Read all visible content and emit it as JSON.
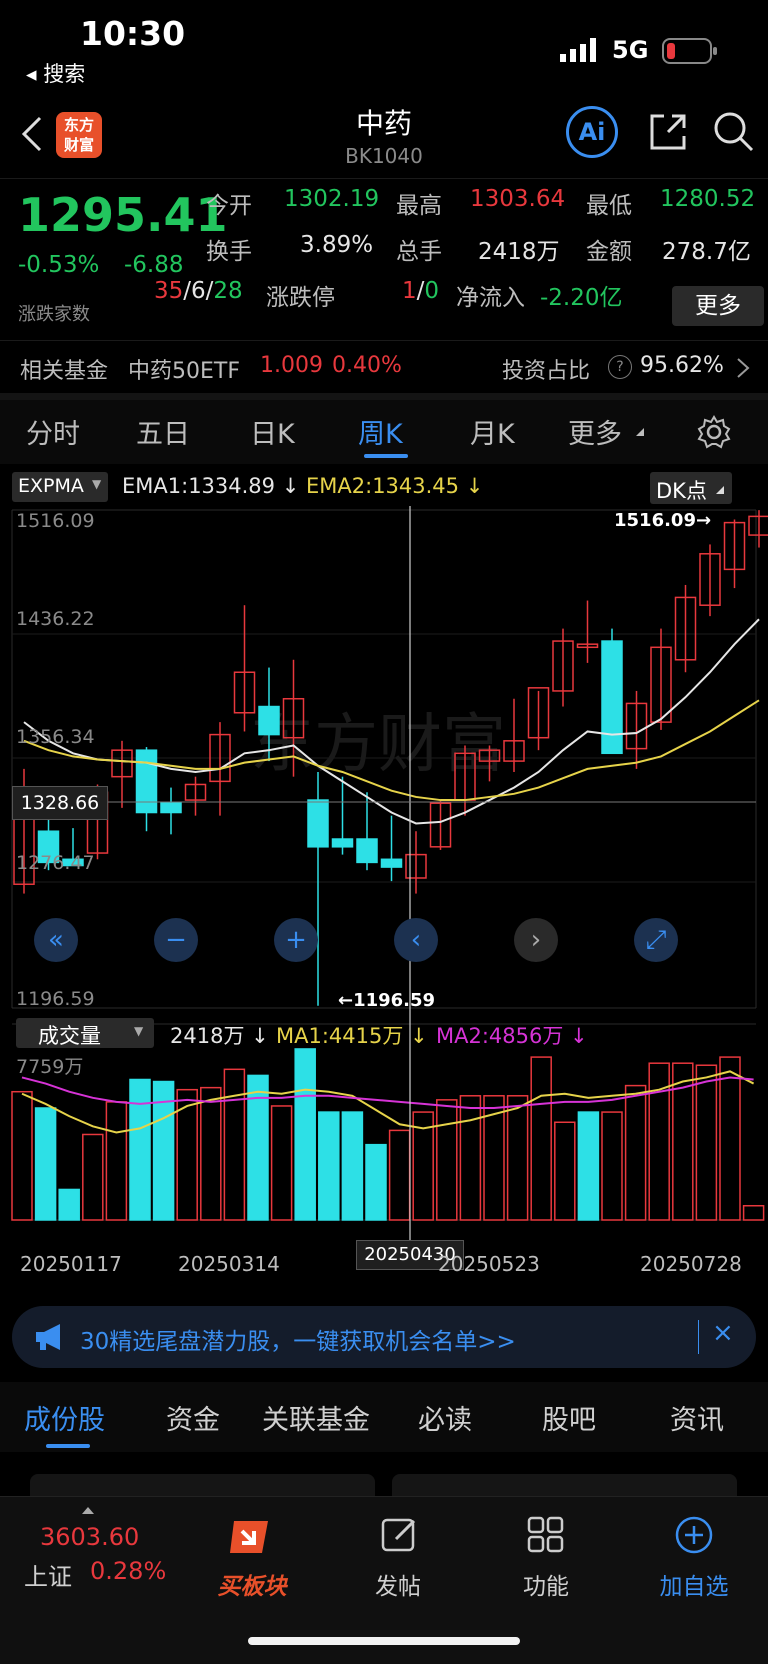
{
  "status_bar": {
    "time": "10:30",
    "back_label": "◂ 搜索",
    "network": "5G"
  },
  "header": {
    "title": "中药",
    "code": "BK1040",
    "logo_line1": "东方",
    "logo_line2": "财富",
    "ai_label": "Ai"
  },
  "quote": {
    "price": "1295.41",
    "change_pct": "-0.53%",
    "change": "-6.88",
    "open_label": "今开",
    "open": "1302.19",
    "high_label": "最高",
    "high": "1303.64",
    "low_label": "最低",
    "low": "1280.52",
    "turnover_label": "换手",
    "turnover": "3.89%",
    "volume_label": "总手",
    "volume": "2418万",
    "amount_label": "金额",
    "amount": "278.7亿",
    "updown_label": "涨跌家数",
    "up": "35",
    "flat": "6",
    "down": "28",
    "limit_label": "涨跌停",
    "limit_up": "1",
    "limit_down": "0",
    "netflow_label": "净流入",
    "netflow": "-2.20亿",
    "more": "更多"
  },
  "fund": {
    "label": "相关基金",
    "name": "中药50ETF",
    "price": "1.009",
    "pct": "0.40%",
    "ratio_label": "投资占比",
    "ratio": "95.62%"
  },
  "tabs": [
    "分时",
    "五日",
    "日K",
    "周K",
    "月K",
    "更多"
  ],
  "active_tab": "周K",
  "indicator": {
    "name": "EXPMA",
    "ema1": "EMA1:1334.89 ↓",
    "ema2": "EMA2:1343.45 ↓",
    "dk": "DK点"
  },
  "axis": {
    "y1": "1516.09",
    "y2": "1436.22",
    "y3": "1356.34",
    "y4": "1276.47",
    "y5": "1196.59",
    "crosshair_price": "1328.66",
    "max_mark": "1516.09→",
    "min_mark": "←1196.59"
  },
  "volume": {
    "name": "成交量",
    "value": "2418万 ↓",
    "ma1": "MA1:4415万 ↓",
    "ma2": "MA2:4856万 ↓",
    "max": "7759万"
  },
  "dates": {
    "d1": "20250117",
    "d2": "20250314",
    "d3": "20250430",
    "d4": "20250523",
    "d5": "20250728"
  },
  "colors": {
    "up": "#e8383d",
    "down": "#2de0e6",
    "ema1": "#e6e6e6",
    "ema2": "#e6d34a",
    "ma2": "#d633d6",
    "accent": "#3a8ef0"
  },
  "chart_data": {
    "type": "candlestick",
    "ylim": [
      1196.59,
      1516.09
    ],
    "candles": [
      {
        "o": 1276,
        "h": 1350,
        "l": 1270,
        "c": 1330
      },
      {
        "o": 1310,
        "h": 1330,
        "l": 1285,
        "c": 1290
      },
      {
        "o": 1292,
        "h": 1312,
        "l": 1288,
        "c": 1288
      },
      {
        "o": 1296,
        "h": 1340,
        "l": 1292,
        "c": 1335
      },
      {
        "o": 1345,
        "h": 1368,
        "l": 1325,
        "c": 1362
      },
      {
        "o": 1362,
        "h": 1364,
        "l": 1310,
        "c": 1322
      },
      {
        "o": 1328,
        "h": 1338,
        "l": 1308,
        "c": 1322
      },
      {
        "o": 1330,
        "h": 1345,
        "l": 1320,
        "c": 1340
      },
      {
        "o": 1342,
        "h": 1380,
        "l": 1320,
        "c": 1372
      },
      {
        "o": 1386,
        "h": 1455,
        "l": 1374,
        "c": 1412
      },
      {
        "o": 1390,
        "h": 1415,
        "l": 1355,
        "c": 1372
      },
      {
        "o": 1370,
        "h": 1420,
        "l": 1345,
        "c": 1395
      },
      {
        "o": 1330,
        "h": 1348,
        "l": 1198,
        "c": 1300
      },
      {
        "o": 1305,
        "h": 1345,
        "l": 1295,
        "c": 1300
      },
      {
        "o": 1305,
        "h": 1335,
        "l": 1285,
        "c": 1290
      },
      {
        "o": 1292,
        "h": 1320,
        "l": 1278,
        "c": 1287
      },
      {
        "o": 1280,
        "h": 1310,
        "l": 1270,
        "c": 1295
      },
      {
        "o": 1300,
        "h": 1330,
        "l": 1298,
        "c": 1328
      },
      {
        "o": 1330,
        "h": 1365,
        "l": 1320,
        "c": 1360
      },
      {
        "o": 1355,
        "h": 1365,
        "l": 1342,
        "c": 1362
      },
      {
        "o": 1355,
        "h": 1395,
        "l": 1348,
        "c": 1368
      },
      {
        "o": 1370,
        "h": 1400,
        "l": 1362,
        "c": 1402
      },
      {
        "o": 1400,
        "h": 1440,
        "l": 1390,
        "c": 1432
      },
      {
        "o": 1428,
        "h": 1458,
        "l": 1418,
        "c": 1430
      },
      {
        "o": 1432,
        "h": 1440,
        "l": 1360,
        "c": 1360
      },
      {
        "o": 1363,
        "h": 1400,
        "l": 1350,
        "c": 1392
      },
      {
        "o": 1380,
        "h": 1440,
        "l": 1375,
        "c": 1428
      },
      {
        "o": 1420,
        "h": 1468,
        "l": 1412,
        "c": 1460
      },
      {
        "o": 1455,
        "h": 1494,
        "l": 1448,
        "c": 1488
      },
      {
        "o": 1478,
        "h": 1510,
        "l": 1466,
        "c": 1508
      },
      {
        "o": 1500,
        "h": 1516,
        "l": 1492,
        "c": 1512
      }
    ],
    "ema1": [
      1380,
      1368,
      1360,
      1356,
      1355,
      1354,
      1350,
      1348,
      1350,
      1360,
      1362,
      1365,
      1352,
      1342,
      1332,
      1322,
      1315,
      1316,
      1322,
      1330,
      1338,
      1348,
      1362,
      1374,
      1372,
      1373,
      1382,
      1396,
      1412,
      1430,
      1446
    ],
    "ema2": [
      1368,
      1362,
      1358,
      1356,
      1355,
      1354,
      1352,
      1350,
      1350,
      1354,
      1356,
      1358,
      1352,
      1348,
      1342,
      1336,
      1332,
      1330,
      1330,
      1332,
      1334,
      1338,
      1344,
      1350,
      1352,
      1354,
      1358,
      1366,
      1374,
      1384,
      1394
    ],
    "volume": [
      6300,
      5500,
      1500,
      4200,
      5800,
      6900,
      6800,
      6400,
      6500,
      7400,
      7100,
      5600,
      8400,
      5300,
      5300,
      3700,
      4400,
      5300,
      5900,
      6100,
      6100,
      6100,
      8000,
      4800,
      5300,
      5300,
      6600,
      7700,
      7700,
      7600,
      8000,
      700
    ],
    "vol_ma1": [
      6200,
      5700,
      5100,
      4600,
      4300,
      4500,
      5000,
      5600,
      5900,
      6100,
      6300,
      6200,
      6400,
      6300,
      6100,
      5400,
      4700,
      4500,
      4700,
      4900,
      5200,
      5500,
      6100,
      6200,
      6000,
      6100,
      6200,
      6400,
      6800,
      7000,
      7300,
      6700
    ],
    "vol_ma2": [
      7000,
      6700,
      6300,
      6000,
      5800,
      5700,
      5800,
      5900,
      5800,
      5900,
      6000,
      6000,
      6100,
      6100,
      6000,
      5900,
      5800,
      5700,
      5600,
      5500,
      5500,
      5600,
      5700,
      5800,
      5800,
      5900,
      6100,
      6300,
      6500,
      6800,
      7000,
      6900
    ],
    "vol_ylim": [
      0,
      7759
    ]
  },
  "controls": [
    "«",
    "−",
    "+",
    "‹",
    "›",
    "⤢"
  ],
  "banner": {
    "text": "30精选尾盘潜力股，一键获取机会名单>>",
    "close": "×"
  },
  "subtabs": [
    "成份股",
    "资金",
    "关联基金",
    "必读",
    "股吧",
    "资讯"
  ],
  "bottom": {
    "index_value": "3603.60",
    "index_name": "上证",
    "index_pct": "0.28%",
    "buy": "买板块",
    "post": "发帖",
    "func": "功能",
    "add": "加自选"
  }
}
